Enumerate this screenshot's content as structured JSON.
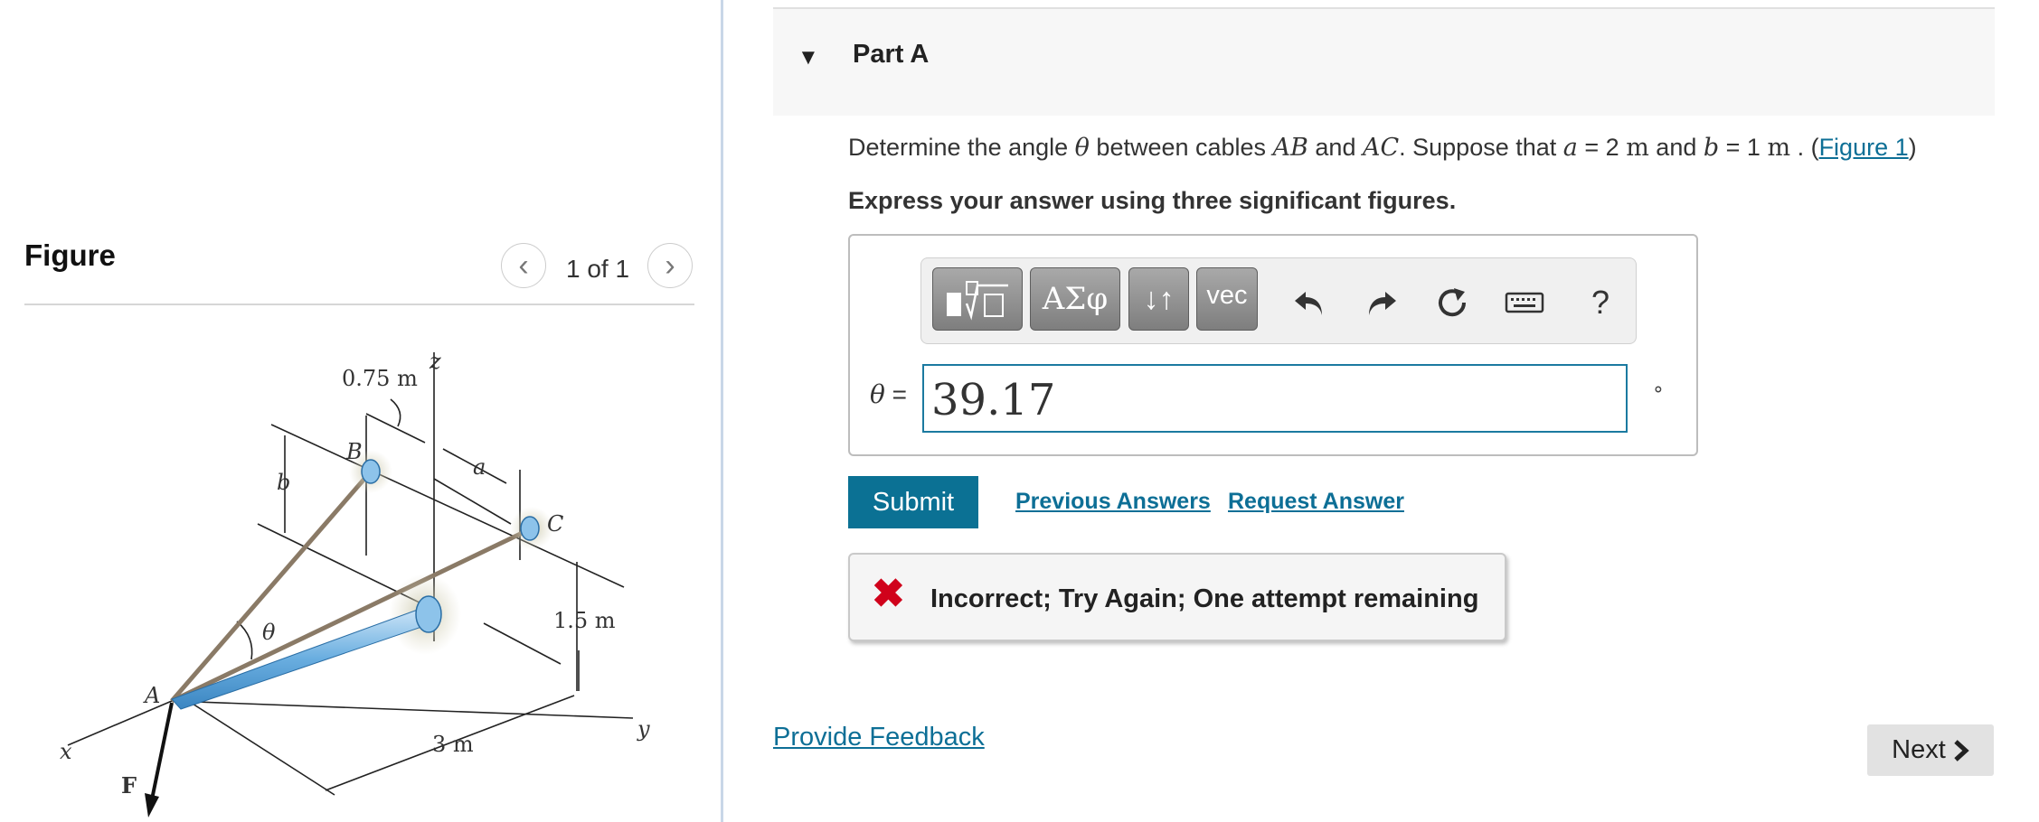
{
  "figure_panel": {
    "title": "Figure",
    "page_indicator": "1 of 1",
    "labels": {
      "dim_075": "0.75 m",
      "z": "z",
      "B": "B",
      "a": "a",
      "b": "b",
      "C": "C",
      "theta": "θ",
      "dim_15": "1.5 m",
      "A": "A",
      "x": "x",
      "y": "y",
      "dim_3": "3 m",
      "F": "F"
    }
  },
  "part": {
    "title": "Part A",
    "question": {
      "t1": "Determine the angle ",
      "theta": "θ",
      "t2": " between cables ",
      "AB": "AB",
      "t3": " and ",
      "AC": "AC",
      "t4": ". Suppose that ",
      "a": "a",
      "t5": " = 2 ",
      "m1": "m",
      "t6": " and ",
      "b": "b",
      "t7": " = 1 ",
      "m2": "m",
      "t8": " . (",
      "figure_link": "Figure 1",
      "t9": ")"
    },
    "instruction": "Express your answer using three significant figures."
  },
  "toolbar": {
    "symbols_label": "ΑΣφ",
    "arrows_label": "↓↑",
    "vec_label": "vec",
    "help_label": "?"
  },
  "answer": {
    "variable": "θ",
    "equals": " =",
    "value": "39.17",
    "unit": "∘"
  },
  "actions": {
    "submit_label": "Submit",
    "previous_answers": "Previous Answers",
    "request_answer": "Request Answer"
  },
  "feedback": {
    "message": "Incorrect; Try Again; One attempt remaining"
  },
  "footer": {
    "provide_feedback": "Provide Feedback",
    "next_label": "Next"
  },
  "colors": {
    "link": "#0d6f96",
    "submit_bg": "#0b7194",
    "error_red": "#d0021b",
    "input_border": "#1b7aa0"
  },
  "icons": [
    "chevron-left-icon",
    "chevron-right-icon",
    "caret-down-icon",
    "templates-icon",
    "undo-icon",
    "redo-icon",
    "reset-icon",
    "keyboard-icon",
    "help-icon",
    "incorrect-x-icon",
    "chevron-right-next-icon"
  ]
}
